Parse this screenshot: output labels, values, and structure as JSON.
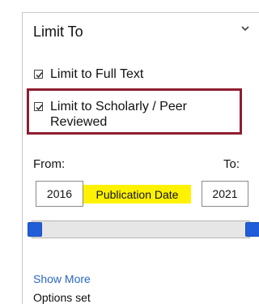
{
  "panel": {
    "title": "Limit To",
    "options": [
      {
        "label": "Limit to Full Text",
        "checked": true
      },
      {
        "label": "Limit to Scholarly / Peer Reviewed",
        "checked": true
      }
    ],
    "range": {
      "from_label": "From:",
      "to_label": "To:",
      "from_value": "2016",
      "to_value": "2021",
      "field_label": "Publication Date"
    },
    "show_more": "Show More",
    "status": "Options set"
  },
  "colors": {
    "highlight_border": "#8f1d32",
    "slider_handle": "#1f5ed8",
    "field_highlight": "#fff200",
    "link": "#2a66c4"
  }
}
